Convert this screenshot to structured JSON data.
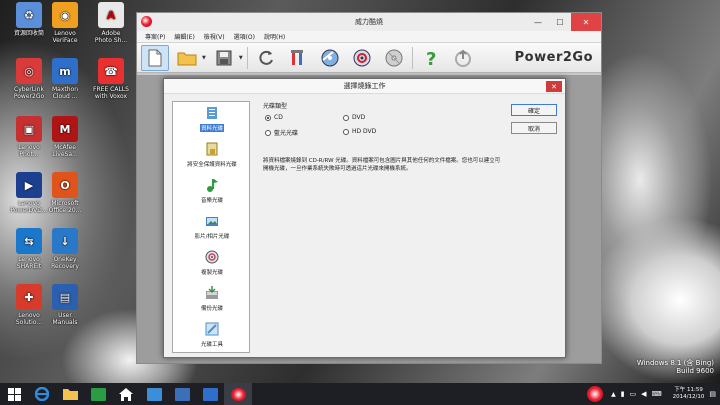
{
  "desktop": {
    "icons": [
      {
        "label": "資源回收筒",
        "color": "#5b8fd9",
        "glyph": "♻"
      },
      {
        "label": "Lenovo\nVeriFace",
        "color": "#f0a020",
        "glyph": "◉"
      },
      {
        "label": "Adobe\nPhoto Sh...",
        "color": "#e8e8e8",
        "glyph": "A"
      },
      {
        "label": "CyberLink\nPower2Go",
        "color": "#d93a3a",
        "glyph": "◎"
      },
      {
        "label": "Maxthon\nCloud ...",
        "color": "#2f6fc9",
        "glyph": "m"
      },
      {
        "label": "FREE CALLS\nwith Voxox",
        "color": "#e83030",
        "glyph": "☎"
      },
      {
        "label": "Lenovo\nPhot...",
        "color": "#c63030",
        "glyph": "▣"
      },
      {
        "label": "McAfee\nLiveSa...",
        "color": "#b01515",
        "glyph": "M"
      },
      {
        "label": "Lenovo\nPowerDVD...",
        "color": "#1d3f8f",
        "glyph": "▶"
      },
      {
        "label": "Microsoft\nOffice 20...",
        "color": "#e0541b",
        "glyph": "O"
      },
      {
        "label": "Lenovo\nSHAREit",
        "color": "#1b77c9",
        "glyph": "⇆"
      },
      {
        "label": "OneKey\nRecovery",
        "color": "#2a78c8",
        "glyph": "↓"
      },
      {
        "label": "Lenovo\nSolutio...",
        "color": "#d73b2b",
        "glyph": "✚"
      },
      {
        "label": "User\nManuals",
        "color": "#2b5fb0",
        "glyph": "▤"
      }
    ]
  },
  "app": {
    "title": "威力酷燒",
    "menu": [
      "專案(P)",
      "編輯(E)",
      "檢視(V)",
      "選項(O)",
      "說明(H)"
    ],
    "brand": "Power2Go",
    "window_controls": {
      "minimize": "—",
      "maximize": "☐",
      "close": "✕"
    }
  },
  "dialog": {
    "title": "選擇燒錄工作",
    "close": "✕",
    "tasks": [
      {
        "label": "資料光碟",
        "icon": "data-disc-icon",
        "color": "#5b9bd5"
      },
      {
        "label": "將安全保護資料光碟",
        "icon": "secure-disc-icon",
        "color": "#c9a227"
      },
      {
        "label": "音樂光碟",
        "icon": "music-disc-icon",
        "color": "#2f9c3c"
      },
      {
        "label": "影片/相片光碟",
        "icon": "video-photo-disc-icon",
        "color": "#4a7fc0"
      },
      {
        "label": "複製光碟",
        "icon": "copy-disc-icon",
        "color": "#c84d4d"
      },
      {
        "label": "備份光碟",
        "icon": "backup-disc-icon",
        "color": "#3f8c4a"
      },
      {
        "label": "光碟工具",
        "icon": "disc-tools-icon",
        "color": "#4d8fc9"
      }
    ],
    "disc_type": {
      "title": "光碟類型",
      "options": [
        {
          "label": "CD",
          "checked": true
        },
        {
          "label": "DVD",
          "checked": false
        },
        {
          "label": "藍光光碟",
          "checked": false
        },
        {
          "label": "HD DVD",
          "checked": false
        }
      ]
    },
    "description": "將資料檔案燒錄到 CD-R/RW 光碟。資料檔案可包含圖片與其他任何的文件檔案。您也可以建立可開機光碟，一旦作業系統失敗時可透過這片光碟來開機系統。",
    "ok_label": "確定",
    "cancel_label": "取消"
  },
  "taskbar": {
    "clock_time": "下午 11:59",
    "clock_date": "2014/12/10"
  },
  "watermark": {
    "line1": "Windows 8.1 (含 Bing)",
    "line2": "Build 9600"
  }
}
